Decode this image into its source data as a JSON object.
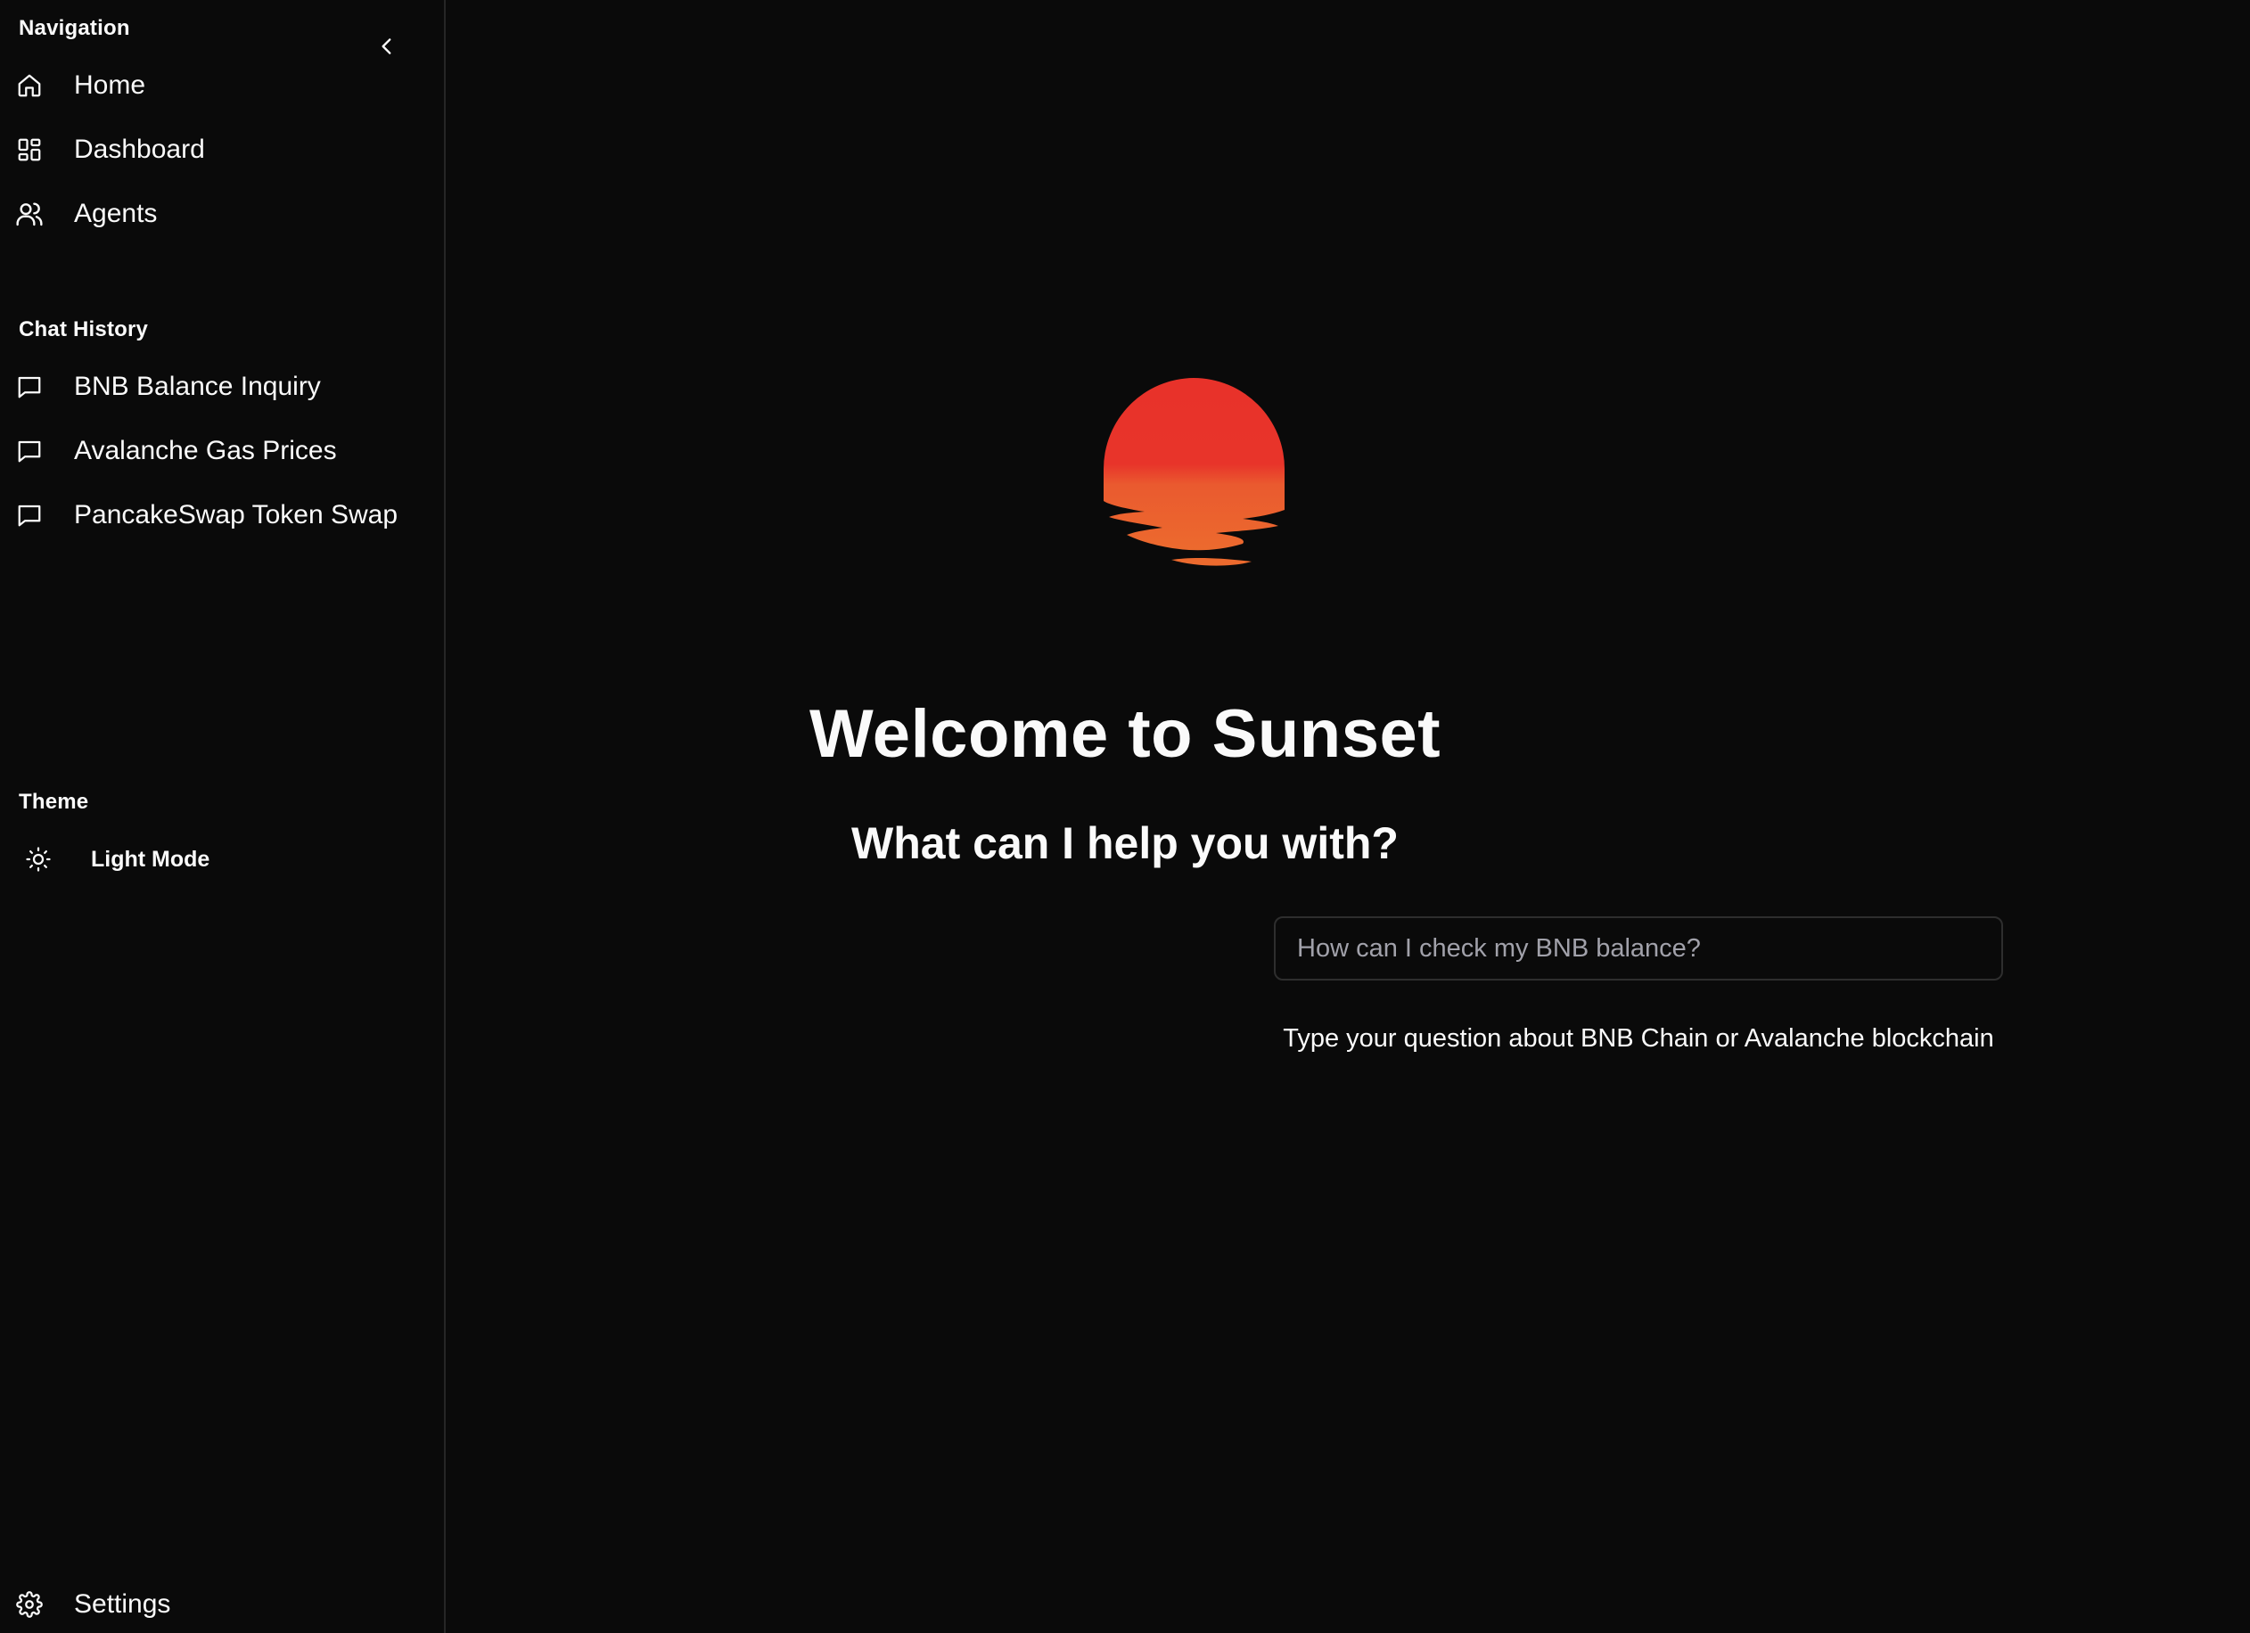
{
  "sidebar": {
    "navigation_label": "Navigation",
    "nav_items": [
      {
        "label": "Home",
        "icon": "home-icon"
      },
      {
        "label": "Dashboard",
        "icon": "dashboard-icon"
      },
      {
        "label": "Agents",
        "icon": "users-icon"
      }
    ],
    "chat_history_label": "Chat History",
    "chat_items": [
      {
        "label": "BNB Balance Inquiry",
        "icon": "message-square-icon"
      },
      {
        "label": "Avalanche Gas Prices",
        "icon": "message-square-icon"
      },
      {
        "label": "PancakeSwap Token Swap",
        "icon": "message-square-icon"
      }
    ],
    "theme_label": "Theme",
    "theme_toggle": {
      "label": "Light Mode",
      "icon": "sun-icon"
    },
    "settings": {
      "label": "Settings",
      "icon": "gear-icon"
    }
  },
  "main": {
    "logo": "sunset-logo",
    "title": "Welcome to Sunset",
    "subtitle": "What can I help you with?",
    "input": {
      "value": "",
      "placeholder": "How can I check my BNB balance?"
    },
    "hint": "Type your question about BNB Chain or Avalanche blockchain"
  },
  "colors": {
    "background": "#0a0a0a",
    "border": "#262626",
    "text": "#fafafa",
    "placeholder": "#a1a1aa",
    "sun_top": "#e8322a",
    "sun_bottom": "#ec6a2e"
  }
}
